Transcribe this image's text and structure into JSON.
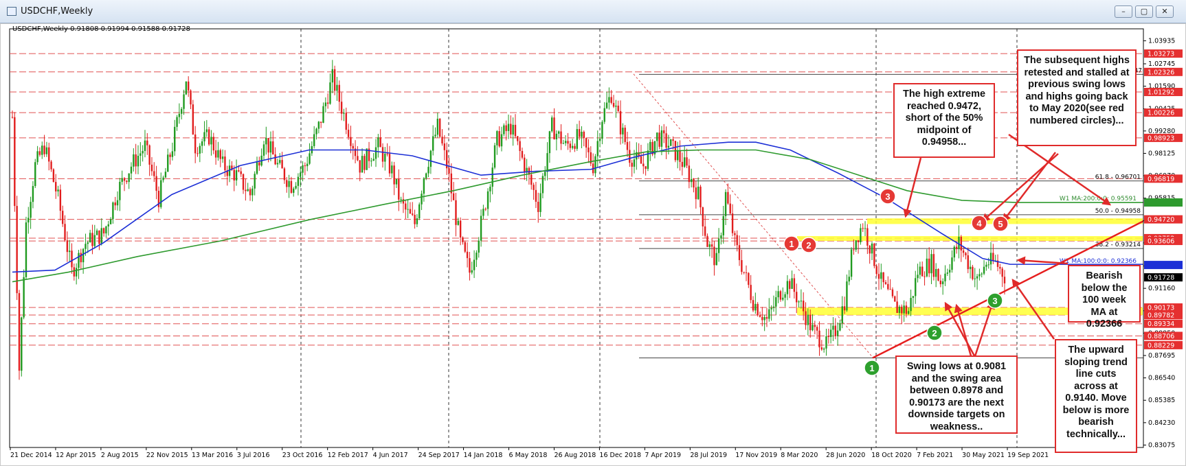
{
  "window": {
    "title": "USDCHF,Weekly",
    "buttons": [
      "–",
      "▢",
      "✕"
    ]
  },
  "symbol_header": "USDCHF,Weekly  0.91808 0.91994 0.91588 0.91728",
  "chart_data": {
    "type": "candlestick",
    "symbol": "USDCHF",
    "timeframe": "Weekly",
    "ohlc_last": {
      "open": 0.91808,
      "high": 0.91994,
      "low": 0.91588,
      "close": 0.91728
    },
    "x_ticks": [
      "21 Dec 2014",
      "12 Apr 2015",
      "2 Aug 2015",
      "22 Nov 2015",
      "13 Mar 2016",
      "3 Jul 2016",
      "23 Oct 2016",
      "12 Feb 2017",
      "4 Jun 2017",
      "24 Sep 2017",
      "14 Jan 2018",
      "6 May 2018",
      "26 Aug 2018",
      "16 Dec 2018",
      "7 Apr 2019",
      "28 Jul 2019",
      "17 Nov 2019",
      "8 Mar 2020",
      "28 Jun 2020",
      "18 Oct 2020",
      "7 Feb 2021",
      "30 May 2021",
      "19 Sep 2021"
    ],
    "y_ticks": [
      "1.03935",
      "1.02745",
      "1.01590",
      "1.00425",
      "0.99280",
      "0.98125",
      "0.96970",
      "0.95815",
      "0.94660",
      "0.93505",
      "0.92315",
      "0.91160",
      "0.90005",
      "0.88850",
      "0.87695",
      "0.86540",
      "0.85385",
      "0.84230",
      "0.83075"
    ],
    "ylim": [
      0.8295,
      1.0455
    ],
    "price_levels": [
      {
        "label": "1.03273",
        "value": 1.03273
      },
      {
        "label": "1.02326",
        "value": 1.02326
      },
      {
        "label": "1.01292",
        "value": 1.01292
      },
      {
        "label": "1.00226",
        "value": 1.00226
      },
      {
        "label": "0.98923",
        "value": 0.98923
      },
      {
        "label": "0.96819",
        "value": 0.96819
      },
      {
        "label": "0.94720",
        "value": 0.9472
      },
      {
        "label": "0.93752",
        "value": 0.93752
      },
      {
        "label": "0.93606",
        "value": 0.93606
      },
      {
        "label": "0.90173",
        "value": 0.90173
      },
      {
        "label": "0.89782",
        "value": 0.89782
      },
      {
        "label": "0.89334",
        "value": 0.89334
      },
      {
        "label": "0.88706",
        "value": 0.88706
      },
      {
        "label": "0.88229",
        "value": 0.88229
      }
    ],
    "fib_levels": [
      {
        "label": "61.8 - 0.96701",
        "value": 0.96701
      },
      {
        "label": "50.0 - 0.94958",
        "value": 0.94958
      },
      {
        "label": "38.2 - 0.93214",
        "value": 0.93214
      }
    ],
    "fib_anchor_high_label": "347",
    "ma_labels": {
      "ma200": "W1 MA:200:0:0: 0.95591",
      "ma100": "W1 MA:100:0:0: 0.92366"
    },
    "current_price_label": "0.91728",
    "ma200_value": 0.95591,
    "ma100_value": 0.92366,
    "current_price": 0.91728,
    "colors": {
      "up": "#1f9a1f",
      "down": "#e11d1d",
      "ma100": "#1c2fd6",
      "ma200": "#2e9a2e",
      "level_line": "#e05050",
      "trendline": "#e61e1e",
      "highlight": "#ffff33"
    }
  },
  "markers": [
    {
      "label": "1",
      "color": "#e53935"
    },
    {
      "label": "2",
      "color": "#e53935"
    },
    {
      "label": "3",
      "color": "#e53935"
    },
    {
      "label": "4",
      "color": "#e53935"
    },
    {
      "label": "5",
      "color": "#e53935"
    },
    {
      "label": "1",
      "color": "#2ea02e"
    },
    {
      "label": "2",
      "color": "#2ea02e"
    },
    {
      "label": "3",
      "color": "#2ea02e"
    }
  ],
  "annotations": {
    "high_extreme": "The high extreme reached 0.9472, short of the 50% midpoint of 0.94958...",
    "subsequent_highs": "The subsequent highs retested and stalled at previous swing lows and highs going back to May 2020(see red numbered circles)...",
    "bearish_ma": "Bearish below the 100 week MA at  0.92366",
    "swing_lows": "Swing lows at 0.9081 and the swing area between 0.8978 and  0.90173 are the next downside targets on weakness..",
    "trend_line": "The upward sloping trend line cuts across at 0.9140. Move below is more bearish technically..."
  }
}
